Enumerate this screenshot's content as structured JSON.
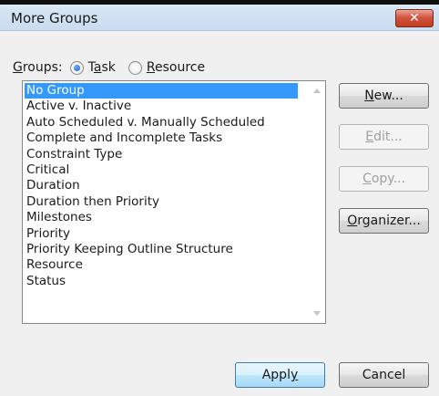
{
  "window": {
    "title": "More Groups",
    "close_glyph": "✕"
  },
  "groups": {
    "label": "Groups:",
    "options": [
      {
        "label": "Task",
        "checked": true
      },
      {
        "label": "Resource",
        "checked": false
      }
    ]
  },
  "list": {
    "items": [
      "No Group",
      "Active v. Inactive",
      "Auto Scheduled v. Manually Scheduled",
      "Complete and Incomplete Tasks",
      "Constraint Type",
      "Critical",
      "Duration",
      "Duration then Priority",
      "Milestones",
      "Priority",
      "Priority Keeping Outline Structure",
      "Resource",
      "Status"
    ],
    "selected_index": 0
  },
  "buttons": {
    "new": "New...",
    "edit": "Edit...",
    "copy": "Copy...",
    "organizer": "Organizer...",
    "apply": "Apply",
    "cancel": "Cancel"
  },
  "colors": {
    "selection": "#3399ff",
    "titlebar": "#c9dcef",
    "close_button": "#c13a20"
  }
}
